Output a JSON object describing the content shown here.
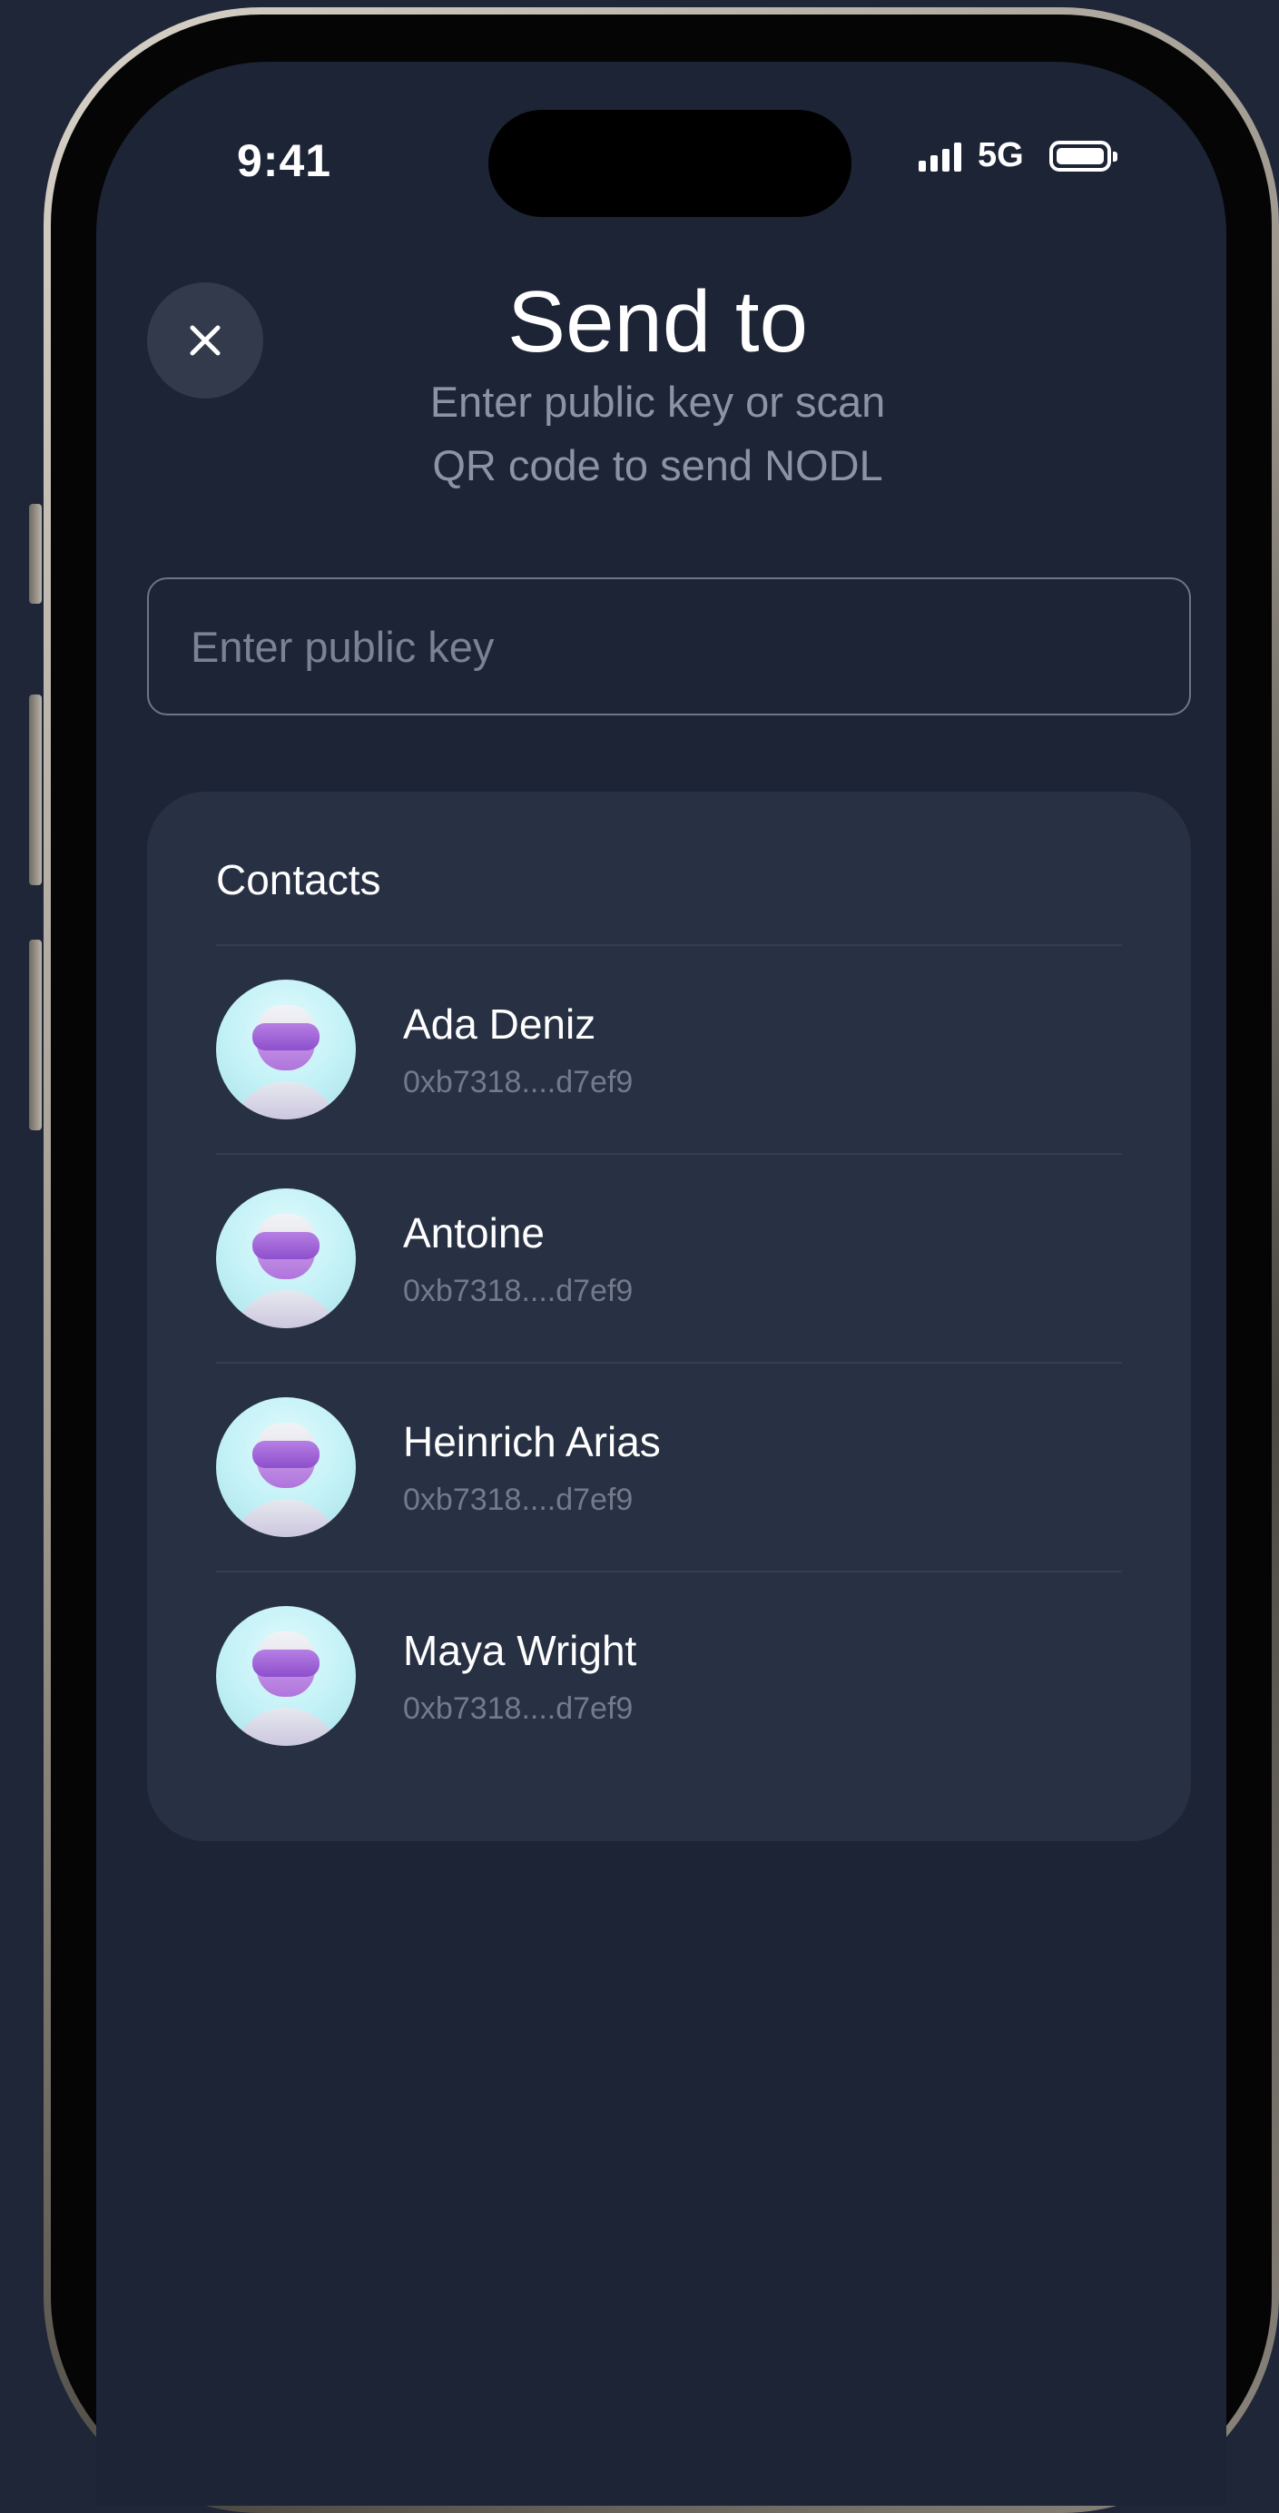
{
  "status_bar": {
    "time": "9:41",
    "network": "5G"
  },
  "header": {
    "title": "Send to",
    "subtitle_line1": "Enter public key or scan",
    "subtitle_line2": "QR code to send NODL"
  },
  "search": {
    "placeholder": "Enter public key",
    "value": ""
  },
  "contacts": {
    "heading": "Contacts",
    "items": [
      {
        "name": "Ada Deniz",
        "address": "0xb7318....d7ef9"
      },
      {
        "name": "Antoine",
        "address": "0xb7318....d7ef9"
      },
      {
        "name": "Heinrich Arias",
        "address": "0xb7318....d7ef9"
      },
      {
        "name": "Maya Wright",
        "address": "0xb7318....d7ef9"
      }
    ]
  },
  "icons": {
    "close": "close-icon",
    "signal": "cellular-signal-icon",
    "battery": "battery-icon",
    "avatar": "avatar-robot-icon"
  },
  "colors": {
    "background": "#1f2638",
    "screen": "#1c2436",
    "card": "#283043",
    "text_primary": "#ffffff",
    "text_secondary": "#8c93a3"
  }
}
